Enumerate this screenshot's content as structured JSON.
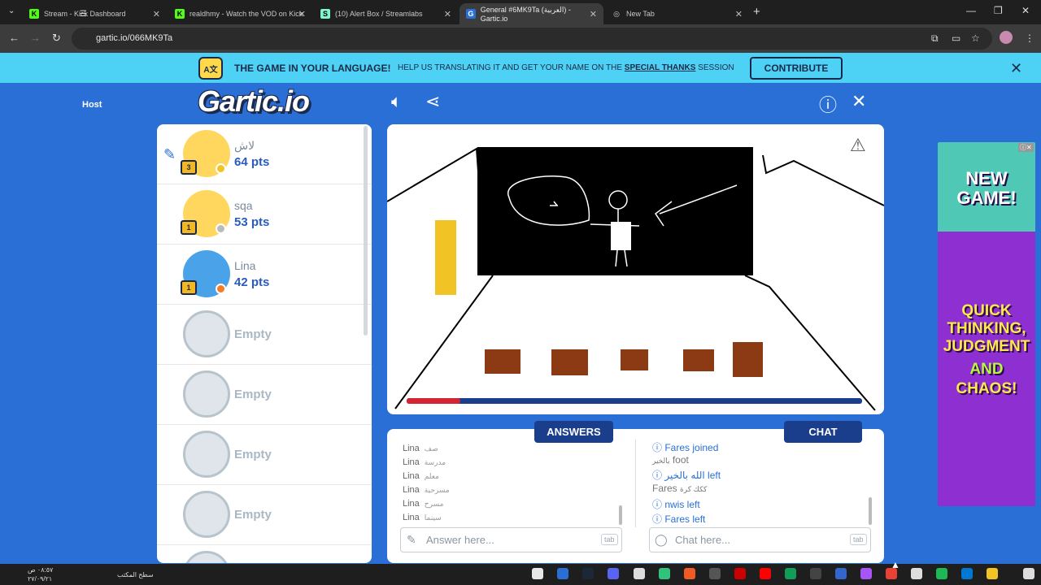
{
  "browser": {
    "tabs": [
      {
        "title": "Stream - Kick Dashboard",
        "icon": "K",
        "color": "#53fc18"
      },
      {
        "title": "realdhmy - Watch the VOD on Kick",
        "icon": "K",
        "color": "#53fc18"
      },
      {
        "title": "(10) Alert Box / Streamlabs",
        "icon": "S",
        "color": "#80f5d2"
      },
      {
        "title": "General #6MK9Ta (العربية) - Gartic.io",
        "icon": "G",
        "color": "#2a6fd6"
      },
      {
        "title": "New Tab",
        "icon": "◎",
        "color": "#cccccc"
      }
    ],
    "url": "gartic.io/066MK9Ta"
  },
  "banner": {
    "title": "THE GAME IN YOUR LANGUAGE!",
    "text_before": "HELP US TRANSLATING IT AND GET YOUR NAME ON THE ",
    "link": "SPECIAL THANKS",
    "text_after": " SESSION",
    "contribute_label": "CONTRIBUTE",
    "icon_text": "A文"
  },
  "logo": "Gartic.io",
  "players": [
    {
      "name": "لاش",
      "points": "64 pts",
      "rank": "3",
      "avatar": "yellow",
      "dot_color": "#f2c324",
      "drawing": true
    },
    {
      "name": "sqa",
      "points": "53 pts",
      "rank": "1",
      "avatar": "yellow",
      "dot_color": "#bbbbbb",
      "host": "Host"
    },
    {
      "name": "Lina",
      "points": "42 pts",
      "rank": "1",
      "avatar": "blue",
      "dot_color": "#f57c24"
    }
  ],
  "empty_label": "Empty",
  "panels": {
    "answers_label": "ANSWERS",
    "chat_label": "CHAT",
    "answer_placeholder": "Answer here...",
    "chat_placeholder": "Chat here...",
    "tab_key": "tab"
  },
  "answers": [
    {
      "who": "Lina",
      "text": "صف"
    },
    {
      "who": "Lina",
      "text": "مدرسة"
    },
    {
      "who": "Lina",
      "text": "معلم"
    },
    {
      "who": "Lina",
      "text": "مسرحية"
    },
    {
      "who": "Lina",
      "text": "مسرح"
    },
    {
      "who": "Lina",
      "text": "سينما"
    }
  ],
  "chat": [
    {
      "type": "info",
      "text": "Fares joined"
    },
    {
      "type": "msg",
      "who": "يالخير",
      "text": "foot"
    },
    {
      "type": "info",
      "text": "الله بالخير left"
    },
    {
      "type": "msg",
      "who": "Fares",
      "text": "ككك كرة"
    },
    {
      "type": "info",
      "text": "nwis left"
    },
    {
      "type": "info",
      "text": "Fares left"
    }
  ],
  "ad": {
    "line1": "NEW",
    "line2": "GAME!",
    "line3": "QUICK",
    "line4": "THINKING,",
    "line5": "JUDGMENT",
    "line6": "AND",
    "line7": "CHAOS!"
  },
  "taskbar": {
    "time": "٠٨:٥٧ ص",
    "date": "٢٧/٠٩/٢١",
    "desktop_label": "سطح المكتب"
  }
}
